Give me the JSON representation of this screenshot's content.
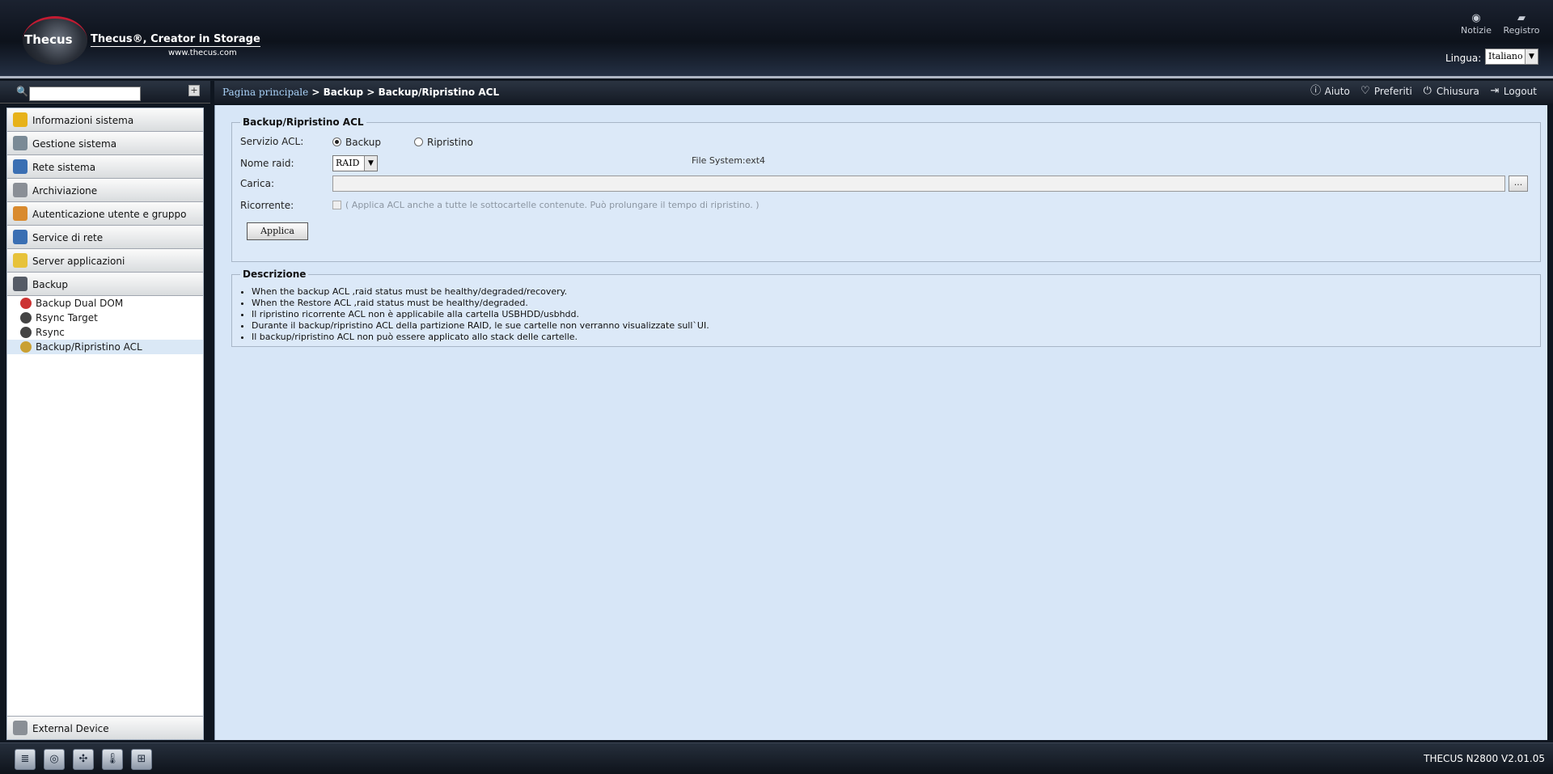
{
  "header": {
    "brand": "Thecus",
    "tagline": "Thecus®, Creator in Storage",
    "site": "www.thecus.com",
    "notizie": "Notizie",
    "registro": "Registro",
    "lang_label": "Lingua:",
    "lang_value": "Italiano"
  },
  "search": {
    "placeholder": ""
  },
  "sidebar": {
    "items": [
      {
        "label": "Informazioni sistema",
        "icon": "info-icon",
        "color": "#e7b21a"
      },
      {
        "label": "Gestione sistema",
        "icon": "tools-icon",
        "color": "#7a8a96"
      },
      {
        "label": "Rete sistema",
        "icon": "network-icon",
        "color": "#3a6fb3"
      },
      {
        "label": "Archiviazione",
        "icon": "storage-icon",
        "color": "#8a8f96"
      },
      {
        "label": "Autenticazione utente e gruppo",
        "icon": "users-icon",
        "color": "#d98a2e"
      },
      {
        "label": "Service di rete",
        "icon": "network-service-icon",
        "color": "#3a6fb3"
      },
      {
        "label": "Server applicazioni",
        "icon": "folder-icon",
        "color": "#e7c23a"
      },
      {
        "label": "Backup",
        "icon": "backup-icon",
        "color": "#555b66"
      }
    ],
    "subitems": [
      {
        "label": "Backup Dual DOM",
        "icon": "dual-dom-icon",
        "color": "#c33"
      },
      {
        "label": "Rsync Target",
        "icon": "rsync-target-icon",
        "color": "#444"
      },
      {
        "label": "Rsync",
        "icon": "rsync-icon",
        "color": "#444"
      },
      {
        "label": "Backup/Ripristino ACL",
        "icon": "acl-icon",
        "color": "#c9a033"
      }
    ],
    "footer": {
      "label": "External Device",
      "icon": "external-device-icon"
    }
  },
  "breadcrumb": {
    "home": "Pagina principale",
    "sep1": " > ",
    "section": "Backup",
    "sep2": " > ",
    "page": "Backup/Ripristino ACL"
  },
  "toolbar": {
    "aiuto": "Aiuto",
    "preferiti": "Preferiti",
    "chiusura": "Chiusura",
    "logout": "Logout"
  },
  "form": {
    "legend": "Backup/Ripristino ACL",
    "acl_label": "Servizio ACL:",
    "opt_backup": "Backup",
    "opt_restore": "Ripristino",
    "raid_label": "Nome raid:",
    "raid_value": "RAID",
    "fs_text": "File System:ext4",
    "carica_label": "Carica:",
    "browse_label": "...",
    "ricorrente_label": "Ricorrente:",
    "ricorrente_text": "( Applica ACL anche a tutte le sottocartelle contenute. Può prolungare il tempo di ripristino. )",
    "apply_label": "Applica"
  },
  "description": {
    "legend": "Descrizione",
    "lines": [
      "When the backup ACL ,raid status must be healthy/degraded/recovery.",
      "When the Restore ACL ,raid status must be healthy/degraded.",
      "Il ripristino ricorrente ACL non è applicabile alla cartella USBHDD/usbhdd.",
      "Durante il backup/ripristino ACL della partizione RAID, le sue cartelle non verranno visualizzate sull`UI.",
      "Il backup/ripristino ACL non può essere applicato allo stack delle cartelle."
    ]
  },
  "statusbar": {
    "version": "THECUS N2800 V2.01.05",
    "icons": [
      "disk-icon",
      "hdd-icon",
      "fan-icon",
      "thermometer-icon",
      "network-tree-icon"
    ]
  }
}
